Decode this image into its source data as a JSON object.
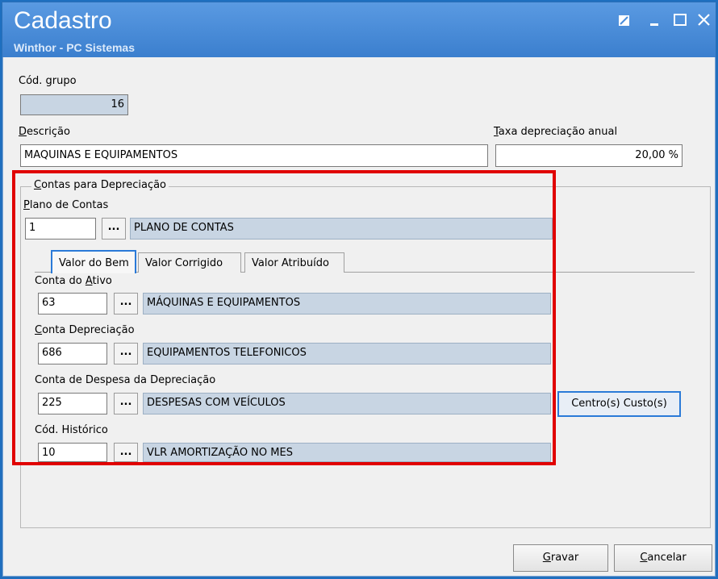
{
  "window": {
    "title": "Cadastro",
    "subtitle": "Winthor - PC Sistemas"
  },
  "header_fields": {
    "cod_grupo_label": "Cód. grupo",
    "cod_grupo_value": "16",
    "descricao_label_first": "D",
    "descricao_label_rest": "escrição",
    "descricao_value": "MAQUINAS E EQUIPAMENTOS",
    "taxa_label_first": "T",
    "taxa_label_rest": "axa depreciação anual",
    "taxa_value": "20,00 %"
  },
  "group": {
    "title_first": "C",
    "title_rest": "ontas para Depreciação",
    "plano_label_first": "P",
    "plano_label_rest": "lano de Contas",
    "plano_code": "1",
    "plano_desc": "PLANO DE CONTAS",
    "dots_label": "..."
  },
  "tabs": [
    {
      "label": "Valor do Bem",
      "active": true
    },
    {
      "label": "Valor Corrigido",
      "active": false
    },
    {
      "label": "Valor Atribuído",
      "active": false
    }
  ],
  "accounts": {
    "ativo_label_pre": "Conta do ",
    "ativo_label_u": "A",
    "ativo_label_post": "tivo",
    "ativo_code": "63",
    "ativo_desc": "MÁQUINAS E EQUIPAMENTOS",
    "deprec_label_u": "C",
    "deprec_label_rest": "onta Depreciação",
    "deprec_code": "686",
    "deprec_desc": "EQUIPAMENTOS TELEFONICOS",
    "despesa_label": "Conta de Despesa da Depreciação",
    "despesa_code": "225",
    "despesa_desc": "DESPESAS COM VEÍCULOS",
    "centro_custo_label": "Centro(s) Custo(s)",
    "historico_label": "Cód. Histórico",
    "historico_code": "10",
    "historico_desc": "VLR AMORTIZAÇÃO NO MES"
  },
  "footer": {
    "gravar_u": "G",
    "gravar_rest": "ravar",
    "cancelar_u": "C",
    "cancelar_rest": "ancelar"
  },
  "colors": {
    "highlight": "#e00000",
    "titlebar": "#4a8ddb",
    "readonly_field": "#c8d5e3",
    "focus_border": "#2a7ad8"
  }
}
